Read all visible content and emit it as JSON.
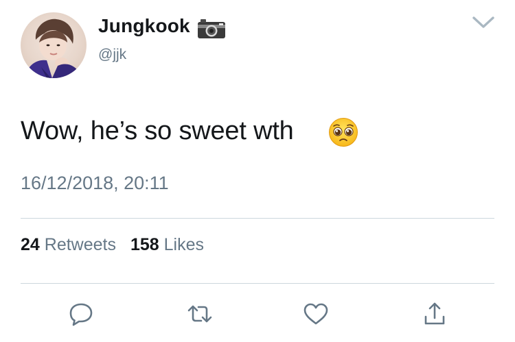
{
  "user": {
    "display_name": "Jungkook",
    "handle": "@jjk",
    "badge_icon": "camera-icon",
    "avatar": "profile-photo"
  },
  "tweet": {
    "text": "Wow, he’s so sweet wth",
    "emoji": "pleading-face-icon",
    "timestamp": "16/12/2018, 20:11"
  },
  "stats": {
    "retweets_count": "24",
    "retweets_label": "Retweets",
    "likes_count": "158",
    "likes_label": "Likes"
  },
  "actions": [
    "reply-icon",
    "retweet-icon",
    "like-icon",
    "share-icon"
  ],
  "colors": {
    "text": "#14171a",
    "secondary": "#657786",
    "divider": "#ccd6dd",
    "icon": "#657786"
  }
}
